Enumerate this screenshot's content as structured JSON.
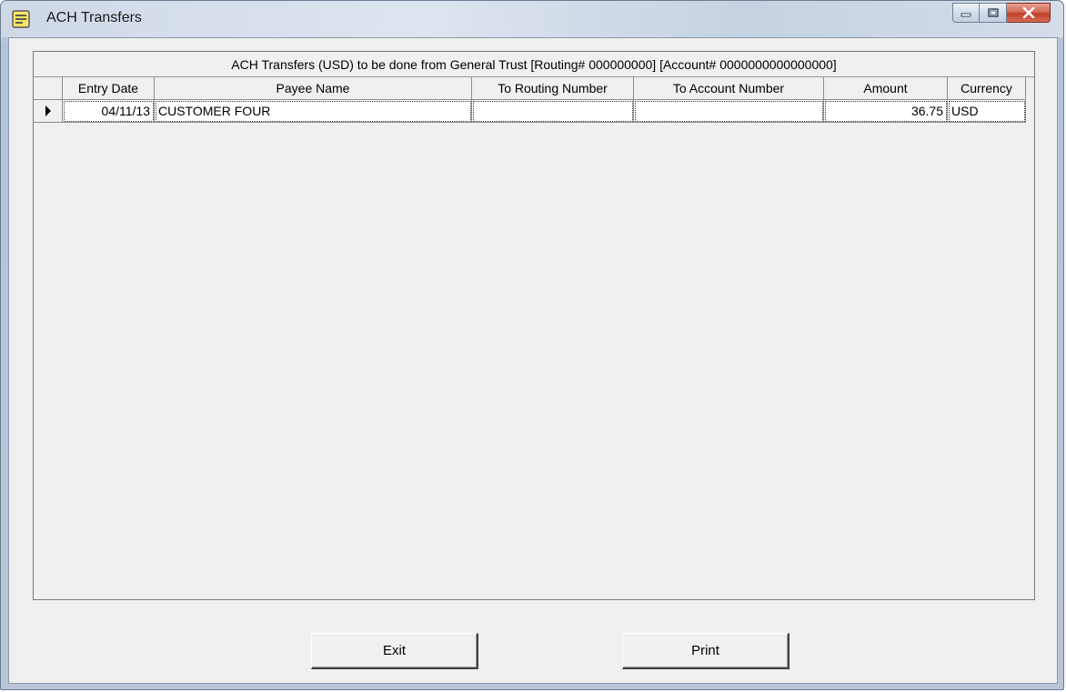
{
  "window": {
    "title": "ACH Transfers",
    "icon": "notepad-list-icon"
  },
  "grid": {
    "caption": "ACH Transfers (USD) to be done from General Trust  [Routing# 000000000]  [Account# 0000000000000000]",
    "columns": [
      "Entry Date",
      "Payee Name",
      "To Routing Number",
      "To Account Number",
      "Amount",
      "Currency"
    ],
    "rows": [
      {
        "entry_date": "04/11/13",
        "payee_name": "CUSTOMER FOUR",
        "to_routing_number": "",
        "to_account_number": "",
        "amount": "36.75",
        "currency": "USD"
      }
    ]
  },
  "buttons": {
    "exit": "Exit",
    "print": "Print"
  },
  "colors": {
    "client_bg": "#f0f0f0",
    "close_button": "#c9503b"
  }
}
